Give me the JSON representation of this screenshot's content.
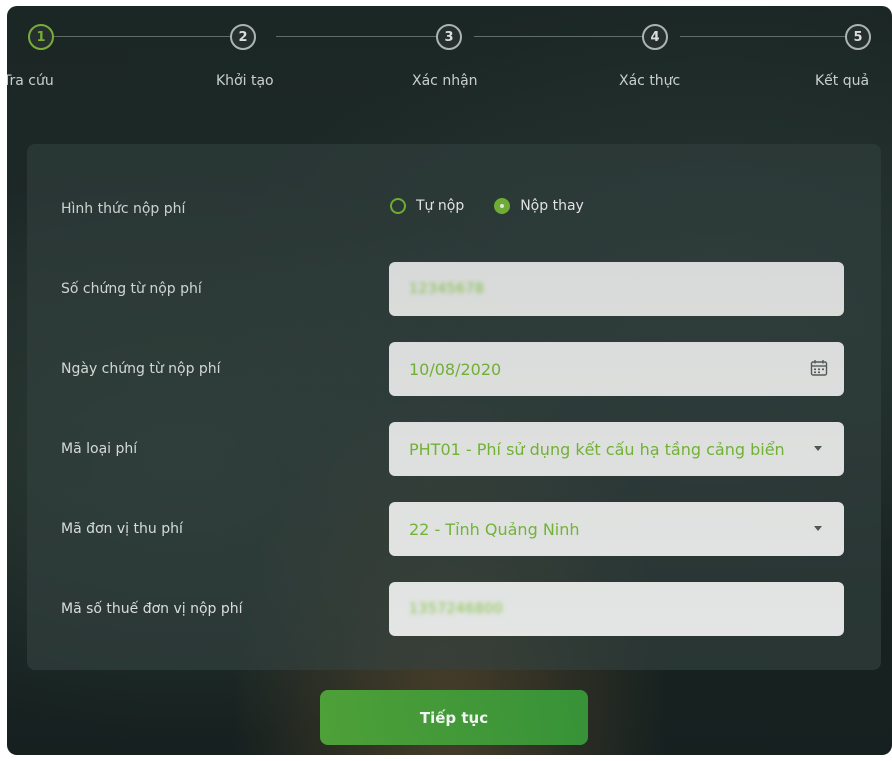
{
  "stepper": {
    "steps": [
      {
        "number": "1",
        "label": "Tra cứu",
        "state": "active"
      },
      {
        "number": "2",
        "label": "Khởi tạo",
        "state": "inactive"
      },
      {
        "number": "3",
        "label": "Xác nhận",
        "state": "inactive"
      },
      {
        "number": "4",
        "label": "Xác thực",
        "state": "inactive"
      },
      {
        "number": "5",
        "label": "Kết quả",
        "state": "inactive"
      }
    ]
  },
  "form": {
    "payment_method": {
      "label": "Hình thức nộp phí",
      "options": [
        {
          "label": "Tự nộp",
          "checked": false
        },
        {
          "label": "Nộp thay",
          "checked": true
        }
      ]
    },
    "receipt_number": {
      "label": "Số chứng từ nộp phí",
      "value": "12345678"
    },
    "receipt_date": {
      "label": "Ngày chứng từ nộp phí",
      "value": "10/08/2020",
      "icon": "calendar-icon"
    },
    "fee_type": {
      "label": "Mã loại phí",
      "value": "PHT01 - Phí sử dụng kết cấu hạ tầng cảng biển"
    },
    "collecting_unit": {
      "label": "Mã đơn vị thu phí",
      "value": "22 - Tỉnh Quảng Ninh"
    },
    "tax_code": {
      "label": "Mã số thuế đơn vị nộp phí",
      "value": "1357246800"
    }
  },
  "actions": {
    "continue_label": "Tiếp tục"
  },
  "colors": {
    "accent": "#7cc13a",
    "button": "#4ca43a",
    "panel": "#374644",
    "field_bg": "#f3f4f3"
  }
}
